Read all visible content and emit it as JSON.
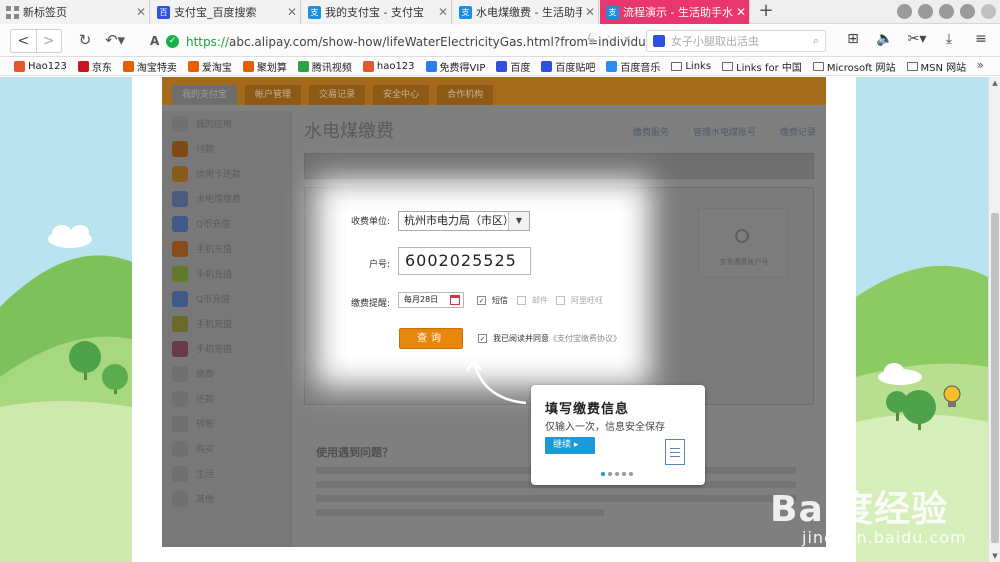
{
  "tabs": [
    {
      "title": "新标签页",
      "icon": "grid-icon"
    },
    {
      "title": "支付宝_百度搜索",
      "icon": "baidu-icon"
    },
    {
      "title": "我的支付宝 - 支付宝",
      "icon": "alipay-icon"
    },
    {
      "title": "水电煤缴费 - 生活助手",
      "icon": "alipay-icon"
    },
    {
      "title": "流程演示 - 生活助手水电...",
      "icon": "alipay-icon",
      "active": true
    }
  ],
  "new_tab_label": "+",
  "address": {
    "url_scheme": "https://",
    "url_rest": "abc.alipay.com/show-how/lifeWaterElectricityGas.html?from=individua",
    "search_placeholder": "女子小腿取出活虫"
  },
  "bookmarks": [
    {
      "label": "Hao123",
      "icon": "hao123-icon",
      "color": "#e4572e"
    },
    {
      "label": "京东",
      "icon": "jd-icon",
      "color": "#c91623"
    },
    {
      "label": "淘宝特卖",
      "icon": "taobao-icon",
      "color": "#e85d04"
    },
    {
      "label": "爱淘宝",
      "icon": "aitaobao-icon",
      "color": "#e85d04"
    },
    {
      "label": "聚划算",
      "icon": "juhuasuan-icon",
      "color": "#e85d04"
    },
    {
      "label": "腾讯视频",
      "icon": "tencent-video-icon",
      "color": "#2aa345"
    },
    {
      "label": "hao123",
      "icon": "hao123-icon",
      "color": "#e4572e"
    },
    {
      "label": "免费得VIP",
      "icon": "vip-icon",
      "color": "#2b7de9"
    },
    {
      "label": "百度",
      "icon": "baidu-icon",
      "color": "#2f4fe0"
    },
    {
      "label": "百度贴吧",
      "icon": "tieba-icon",
      "color": "#2f4fe0"
    },
    {
      "label": "百度音乐",
      "icon": "baidu-music-icon",
      "color": "#2b8de9"
    },
    {
      "label": "Links",
      "icon": "folder-icon",
      "color": "#666666"
    },
    {
      "label": "Links for 中国",
      "icon": "folder-icon",
      "color": "#666666"
    },
    {
      "label": "Microsoft 网站",
      "icon": "folder-icon",
      "color": "#666666"
    },
    {
      "label": "MSN 网站",
      "icon": "folder-icon",
      "color": "#666666"
    }
  ],
  "shot": {
    "tabs": [
      "我的支付宝",
      "帐户管理",
      "交易记录",
      "安全中心",
      "合作机构"
    ],
    "page_title": "水电煤缴费",
    "links": [
      "缴费服务",
      "管理水电煤账号",
      "缴费记录"
    ],
    "sidebar_items": [
      {
        "label": "我的应用",
        "color": "#707070"
      },
      {
        "label": "付款",
        "color": "#7d4a16"
      },
      {
        "label": "信用卡还款",
        "color": "#8a5a1a"
      },
      {
        "label": "水电煤缴费",
        "color": "#4a5d80"
      },
      {
        "label": "Q币充值",
        "color": "#405a88"
      },
      {
        "label": "手机充值",
        "color": "#8a4a1a"
      },
      {
        "label": "手机充值",
        "color": "#5e7a2a"
      },
      {
        "label": "Q币充值",
        "color": "#405a88"
      },
      {
        "label": "手机充值",
        "color": "#6a6a2a"
      },
      {
        "label": "手机充值",
        "color": "#6a3a4a"
      },
      {
        "label": "缴费",
        "color": "#707070"
      },
      {
        "label": "还款",
        "color": "#707070"
      },
      {
        "label": "转账",
        "color": "#707070"
      },
      {
        "label": "购买",
        "color": "#707070"
      },
      {
        "label": "生活",
        "color": "#707070"
      },
      {
        "label": "其他",
        "color": "#707070"
      }
    ],
    "help_title": "使用遇到问题？",
    "side_widget_text": "查看缴费账户号"
  },
  "form": {
    "unit_label": "收费单位:",
    "unit_value": "杭州市电力局（市区）",
    "account_label": "户号:",
    "account_value": "6002025525",
    "remind_label": "缴费提醒:",
    "date_value": "每月28日",
    "sms_label": "短信",
    "mail_label": "邮件",
    "wangwang_label": "阿里旺旺",
    "query_label": "查询",
    "agree_text": "我已阅读并同意",
    "agree_link": "《支付宝缴费协议》"
  },
  "tip": {
    "title": "填写缴费信息",
    "desc": "仅输入一次，信息安全保存",
    "continue": "继续 ▸"
  },
  "watermark": {
    "big": "Bai度经验",
    "small": "jingyan.baidu.com"
  }
}
